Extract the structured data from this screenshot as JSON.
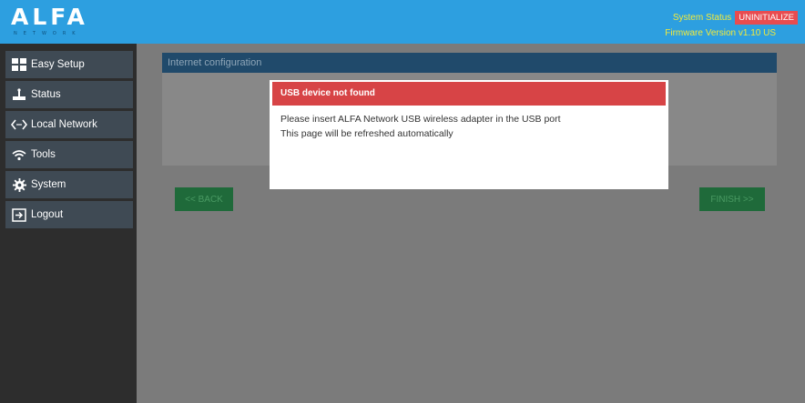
{
  "header": {
    "logo_text": "ALFA",
    "logo_subtext": "NETWORK",
    "system_status_label": "System Status",
    "system_status_value": "UNINITIALIZE",
    "firmware_label": "Firmware Version",
    "firmware_version": "v1.10 US"
  },
  "sidebar": {
    "items": [
      {
        "label": "Easy Setup",
        "icon": "easy-setup-icon"
      },
      {
        "label": "Status",
        "icon": "status-icon"
      },
      {
        "label": "Local Network",
        "icon": "local-network-icon"
      },
      {
        "label": "Tools",
        "icon": "wifi-icon"
      },
      {
        "label": "System",
        "icon": "gear-icon"
      },
      {
        "label": "Logout",
        "icon": "logout-icon"
      }
    ]
  },
  "main": {
    "section_title": "Internet configuration",
    "back_label": "<< BACK",
    "finish_label": "FINISH >>"
  },
  "modal": {
    "title": "USB device not found",
    "line1": "Please insert ALFA Network USB wireless adapter in the USB port",
    "line2": "This page will be refreshed automatically"
  },
  "colors": {
    "header_bg": "#2d9fe0",
    "status_badge": "#e84c50",
    "modal_header": "#d74446",
    "button_green": "#1f6a3a",
    "section_header": "#204a6b"
  }
}
